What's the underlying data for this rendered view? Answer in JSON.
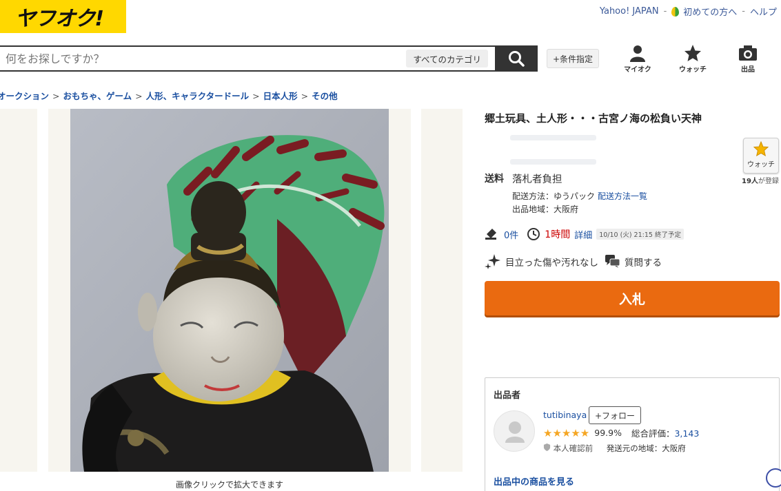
{
  "header": {
    "logo_text": "ヤフオク!",
    "links": [
      "Yahoo! JAPAN",
      "初めての方へ",
      "ヘルプ"
    ],
    "search_placeholder": "何をお探しですか？",
    "category_label": "すべてのカテゴリ",
    "condition_label": "+条件指定",
    "nav": [
      {
        "label": "マイオク",
        "icon": "person-icon"
      },
      {
        "label": "ウォッチ",
        "icon": "star-icon"
      },
      {
        "label": "出品",
        "icon": "camera-icon"
      }
    ]
  },
  "breadcrumb": [
    "オークション",
    "おもちゃ、ゲーム",
    "人形、キャラクタードール",
    "日本人形",
    "その他"
  ],
  "gallery": {
    "caption": "画像クリックで拡大できます",
    "image": "clay-doll-photo"
  },
  "item": {
    "title": "郷土玩具、土人形・・・古宮ノ海の松負い天神",
    "watch_label": "ウォッチ",
    "watch_count_num": "19人",
    "watch_count_suffix": "が登録",
    "shipping_label": "送料",
    "shipping_value": "落札者負担",
    "shipping_method": "配送方法：ゆうパック",
    "shipping_method_link": "配送方法一覧",
    "shipping_region": "出品地域：大阪府",
    "bids": "0件",
    "time_left": "1時間",
    "detail_label": "詳細",
    "end_time": "10/10 (火) 21:15 終了予定",
    "condition": "目立った傷や汚れなし",
    "question_label": "質問する",
    "bid_button": "入札"
  },
  "seller": {
    "heading": "出品者",
    "name": "tutibinaya",
    "follow_label": "+フォロー",
    "stars": "★★★★★",
    "rating_pct": "99.9%",
    "total_label": "総合評価：",
    "total_value": "3,143",
    "verified": "本人確認前",
    "origin": "発送元の地域：大阪府",
    "items_link": "出品中の商品を見る"
  },
  "colors": {
    "brand_yellow": "#ffd800",
    "bid_orange": "#ea6a10",
    "link_blue": "#1a4fa0",
    "time_red": "#cc0000"
  }
}
